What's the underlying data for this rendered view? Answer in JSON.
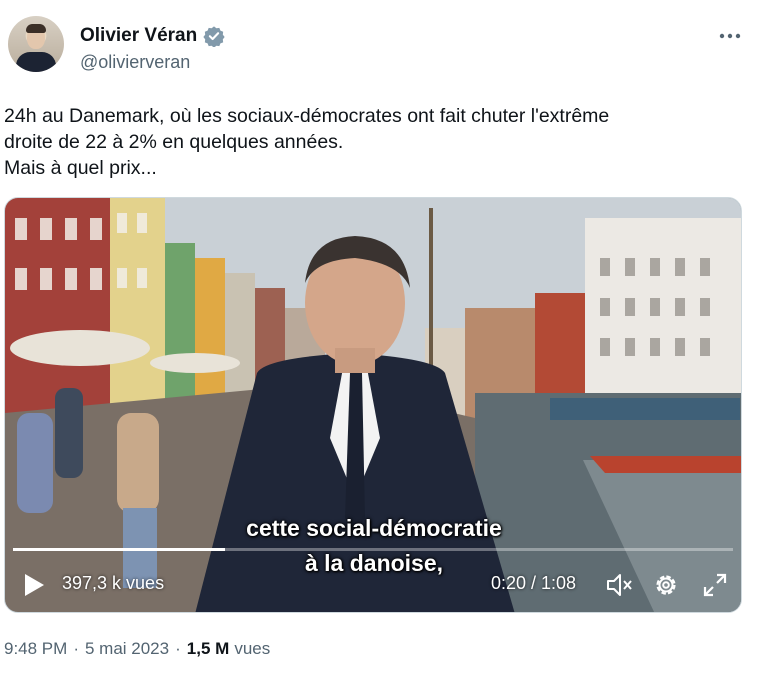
{
  "author": {
    "display_name": "Olivier Véran",
    "handle": "@olivierveran",
    "verified_icon": "verified-badge-icon",
    "verified_color": "#829aab"
  },
  "menu": {
    "icon": "more-horizontal-icon"
  },
  "tweet": {
    "lines": [
      "24h au Danemark, où les sociaux-démocrates ont fait chuter l'extrême",
      "droite de 22 à 2% en quelques années.",
      "Mais à quel prix..."
    ]
  },
  "video": {
    "subtitle_line1": "cette social-démocratie",
    "subtitle_line2": "à la danoise,",
    "views": "397,3 k vues",
    "time": "0:20 / 1:08",
    "progress_fraction": 0.294,
    "icons": [
      "play-icon",
      "mute-icon",
      "settings-icon",
      "fullscreen-icon"
    ]
  },
  "meta": {
    "time": "9:48 PM",
    "separator": "·",
    "date": "5 mai 2023",
    "view_count": "1,5 M",
    "views_label": "vues"
  },
  "colors": {
    "text": "#0f1419",
    "secondary": "#536471",
    "border": "#cfd9de"
  }
}
